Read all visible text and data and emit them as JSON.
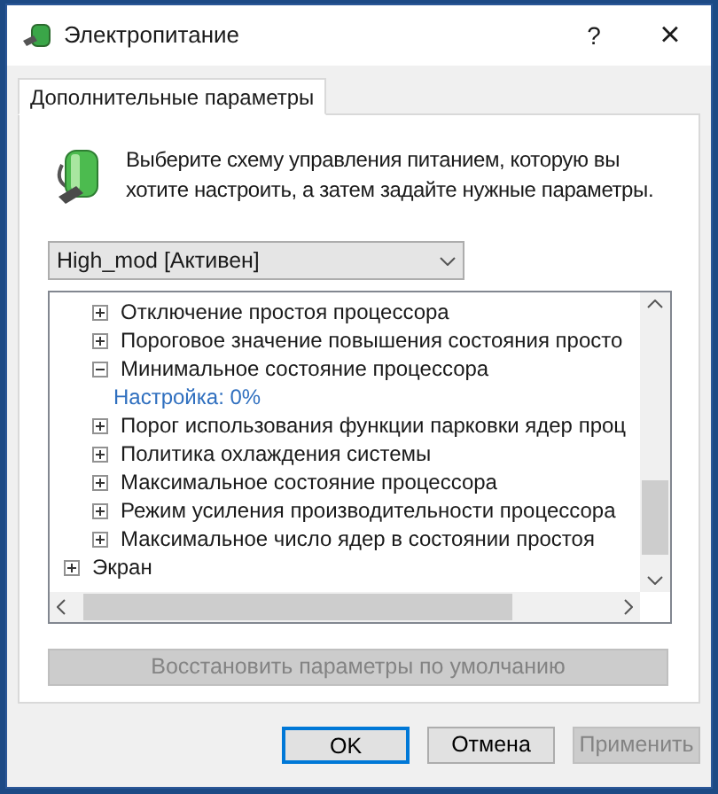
{
  "window": {
    "title": "Электропитание",
    "help": "?",
    "close": "×"
  },
  "tabs": [
    {
      "label": "Дополнительные параметры",
      "selected": true
    }
  ],
  "intro": "Выберите схему управления питанием, которую вы хотите настроить, а затем задайте нужные параметры.",
  "plan_dropdown": {
    "value": "High_mod [Активен]"
  },
  "tree": {
    "items": [
      {
        "children": [
          {
            "label": "Отключение простоя процессора",
            "expanded": false
          },
          {
            "label": "Пороговое значение повышения состояния просто",
            "expanded": false
          },
          {
            "label": "Минимальное состояние процессора",
            "expanded": true,
            "children": [
              {
                "kind": "setting",
                "label": "Настройка: 0%"
              }
            ]
          },
          {
            "label": "Порог использования функции парковки ядер проц",
            "expanded": false
          },
          {
            "label": "Политика охлаждения системы",
            "expanded": false
          },
          {
            "label": "Максимальное состояние процессора",
            "expanded": false
          },
          {
            "label": "Режим усиления производительности процессора",
            "expanded": false
          },
          {
            "label": "Максимальное число ядер в состоянии простоя",
            "expanded": false
          }
        ]
      },
      {
        "label": "Экран",
        "expanded": false
      }
    ]
  },
  "restore_button": {
    "label": "Восстановить параметры по умолчанию",
    "disabled": true
  },
  "buttons": [
    {
      "label": "OK",
      "disabled": false,
      "default": true
    },
    {
      "label": "Отмена",
      "disabled": false,
      "default": false
    },
    {
      "label": "Применить",
      "disabled": true,
      "default": false
    }
  ]
}
